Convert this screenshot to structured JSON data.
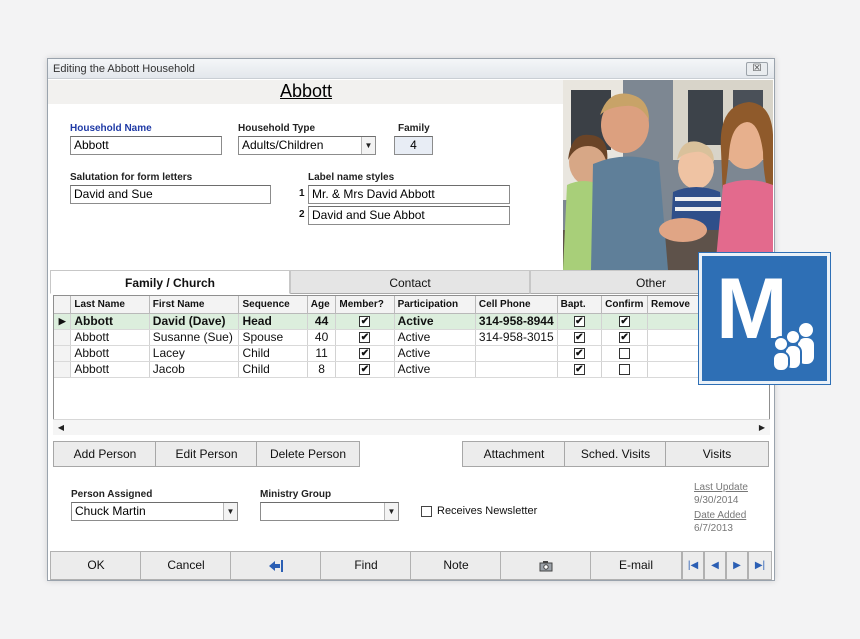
{
  "window": {
    "title": "Editing the Abbott Household",
    "close_glyph": "☒"
  },
  "header": {
    "family_title": "Abbott"
  },
  "form": {
    "household_name_label": "Household Name",
    "household_name_value": "Abbott",
    "household_type_label": "Household Type",
    "household_type_value": "Adults/Children",
    "family_label": "Family",
    "family_value": "4",
    "salutation_label": "Salutation for form letters",
    "salutation_value": "David and Sue",
    "label_styles_label": "Label name styles",
    "label_style_1_num": "1",
    "label_style_1": "Mr. & Mrs David Abbott",
    "label_style_2_num": "2",
    "label_style_2": "David and Sue Abbot"
  },
  "tabs": [
    {
      "label": "Family / Church",
      "active": true
    },
    {
      "label": "Contact",
      "active": false
    },
    {
      "label": "Other",
      "active": false
    }
  ],
  "grid": {
    "columns": [
      "Last Name",
      "First Name",
      "Sequence",
      "Age",
      "Member?",
      "Participation",
      "Cell Phone",
      "Bapt.",
      "Confirm",
      "Remove"
    ],
    "rows": [
      {
        "last": "Abbott",
        "first": "David (Dave)",
        "sequence": "Head",
        "age": "44",
        "member": true,
        "participation": "Active",
        "cell": "314-958-8944",
        "bapt": true,
        "confirm": true,
        "current": true
      },
      {
        "last": "Abbott",
        "first": "Susanne (Sue)",
        "sequence": "Spouse",
        "age": "40",
        "member": true,
        "participation": "Active",
        "cell": "314-958-3015",
        "bapt": true,
        "confirm": true,
        "current": false
      },
      {
        "last": "Abbott",
        "first": "Lacey",
        "sequence": "Child",
        "age": "11",
        "member": true,
        "participation": "Active",
        "cell": "",
        "bapt": true,
        "confirm": false,
        "current": false
      },
      {
        "last": "Abbott",
        "first": "Jacob",
        "sequence": "Child",
        "age": "8",
        "member": true,
        "participation": "Active",
        "cell": "",
        "bapt": true,
        "confirm": false,
        "current": false
      }
    ]
  },
  "actions": {
    "add_person": "Add Person",
    "edit_person": "Edit Person",
    "delete_person": "Delete Person",
    "attachment": "Attachment",
    "sched_visits": "Sched. Visits",
    "visits": "Visits"
  },
  "lower": {
    "person_assigned_label": "Person Assigned",
    "person_assigned_value": "Chuck Martin",
    "ministry_group_label": "Ministry Group",
    "ministry_group_value": "",
    "receives_newsletter_label": "Receives Newsletter",
    "last_update_label": "Last Update",
    "last_update_value": "9/30/2014",
    "date_added_label": "Date Added",
    "date_added_value": "6/7/2013"
  },
  "bottom": {
    "ok": "OK",
    "cancel": "Cancel",
    "find": "Find",
    "note": "Note",
    "email": "E-mail"
  },
  "logo": {
    "letter": "M"
  }
}
